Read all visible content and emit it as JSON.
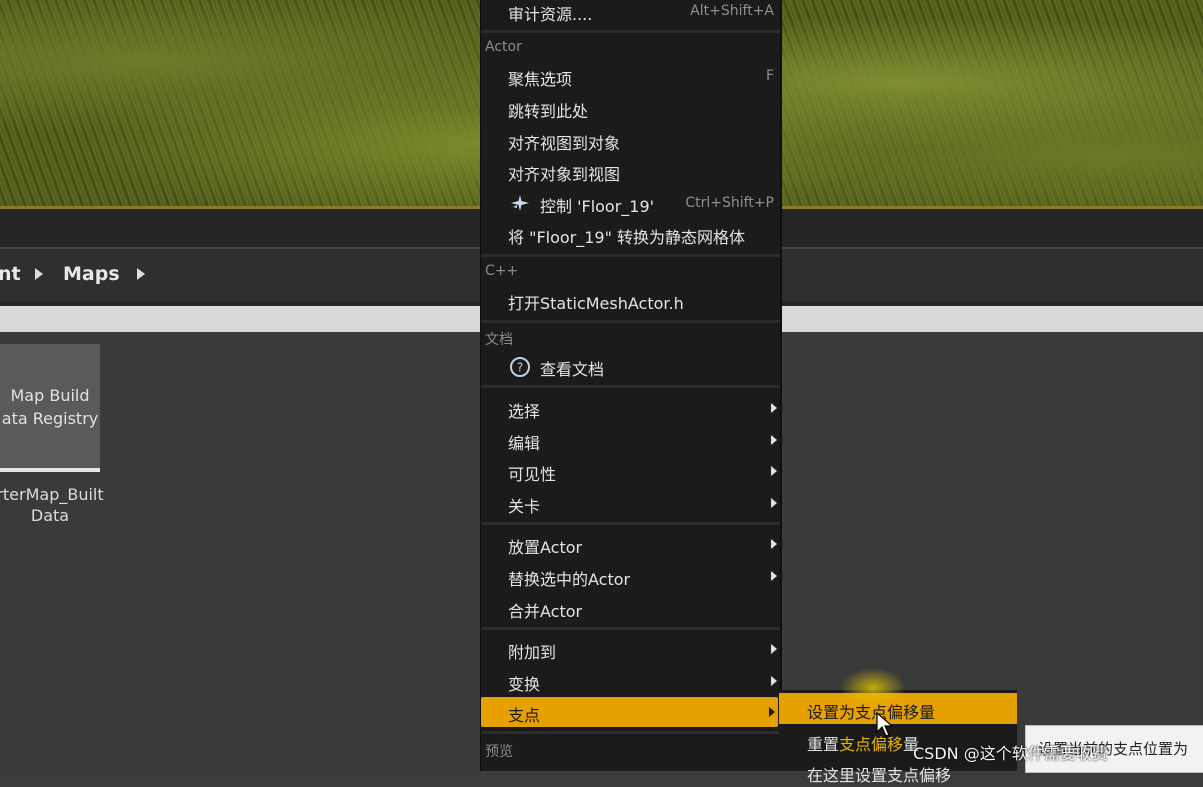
{
  "breadcrumb": {
    "parent_partial": "nt",
    "current": "Maps"
  },
  "asset": {
    "thumb_line1": "Map Build",
    "thumb_line2": "ata Registry",
    "label_line1": "rterMap_Built",
    "label_line2": "Data"
  },
  "context_menu": {
    "top_item": {
      "label": "审计资源....",
      "shortcut": "Alt+Shift+A"
    },
    "sections": {
      "actor": "Actor",
      "cpp": "C++",
      "docs": "文档",
      "preview": "预览"
    },
    "actor_items": [
      {
        "label": "聚焦选项",
        "shortcut": "F"
      },
      {
        "label": "跳转到此处",
        "shortcut": ""
      },
      {
        "label": "对齐视图到对象",
        "shortcut": ""
      },
      {
        "label": "对齐对象到视图",
        "shortcut": ""
      },
      {
        "label": "控制 'Floor_19'",
        "shortcut": "Ctrl+Shift+P",
        "icon": "airplane-icon"
      },
      {
        "label": "将 \"Floor_19\" 转换为静态网格体",
        "shortcut": ""
      }
    ],
    "cpp_item": "打开StaticMeshActor.h",
    "docs_item": {
      "label": "查看文档",
      "icon": "help-icon"
    },
    "group1": [
      "选择",
      "编辑",
      "可见性",
      "关卡"
    ],
    "group2": [
      "放置Actor",
      "替换选中的Actor",
      "合并Actor"
    ],
    "group3": [
      "附加到",
      "变换",
      "支点"
    ]
  },
  "pivot_submenu": {
    "items": [
      "设置为支点偏移量",
      "重置支点偏移量",
      "在这里设置支点偏移"
    ],
    "reset_prefix": "重置",
    "reset_highlight": "支点偏移",
    "reset_suffix": "量"
  },
  "tooltip": {
    "text": "设置当前的支点位置为"
  },
  "watermark": "CSDN @这个软件需要收费"
}
